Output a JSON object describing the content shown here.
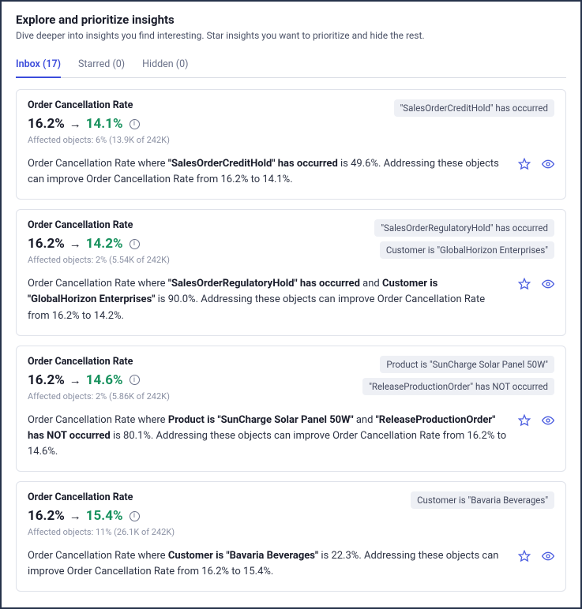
{
  "header": {
    "title": "Explore and prioritize insights",
    "subtitle": "Dive deeper into insights you find interesting. Star insights you want to prioritize and hide the rest."
  },
  "tabs": {
    "inbox": "Inbox (17)",
    "starred": "Starred (0)",
    "hidden": "Hidden (0)"
  },
  "arrow": "→",
  "info_glyph": "i",
  "cards": [
    {
      "metric": "Order Cancellation Rate",
      "before": "16.2%",
      "after": "14.1%",
      "affected": "Affected objects: 6% (13.9K of 242K)",
      "chips": [
        "\"SalesOrderCreditHold\" has occurred"
      ],
      "desc_pre": "Order Cancellation Rate where ",
      "desc_bold1": "\"SalesOrderCreditHold\" has occurred",
      "desc_mid1": " is 49.6%. Addressing these objects can improve Order Cancellation Rate from 16.2% to 14.1%.",
      "desc_bold2": "",
      "desc_mid2": ""
    },
    {
      "metric": "Order Cancellation Rate",
      "before": "16.2%",
      "after": "14.2%",
      "affected": "Affected objects: 2% (5.54K of 242K)",
      "chips": [
        "\"SalesOrderRegulatoryHold\" has occurred",
        "Customer is \"GlobalHorizon Enterprises\""
      ],
      "desc_pre": "Order Cancellation Rate where ",
      "desc_bold1": "\"SalesOrderRegulatoryHold\" has occurred",
      "desc_mid1": " and ",
      "desc_bold2": "Customer is \"GlobalHorizon Enterprises\"",
      "desc_mid2": " is 90.0%. Addressing these objects can improve Order Cancellation Rate from 16.2% to 14.2%."
    },
    {
      "metric": "Order Cancellation Rate",
      "before": "16.2%",
      "after": "14.6%",
      "affected": "Affected objects: 2% (5.86K of 242K)",
      "chips": [
        "Product is \"SunCharge Solar Panel 50W\"",
        "\"ReleaseProductionOrder\" has NOT occurred"
      ],
      "desc_pre": "Order Cancellation Rate where ",
      "desc_bold1": "Product is \"SunCharge Solar Panel 50W\"",
      "desc_mid1": " and ",
      "desc_bold2": "\"ReleaseProductionOrder\" has NOT occurred",
      "desc_mid2": " is 80.1%. Addressing these objects can improve Order Cancellation Rate from 16.2% to 14.6%."
    },
    {
      "metric": "Order Cancellation Rate",
      "before": "16.2%",
      "after": "15.4%",
      "affected": "Affected objects: 11% (26.1K of 242K)",
      "chips": [
        "Customer is \"Bavaria Beverages\""
      ],
      "desc_pre": "Order Cancellation Rate where ",
      "desc_bold1": "Customer is \"Bavaria Beverages\"",
      "desc_mid1": " is 22.3%. Addressing these objects can improve Order Cancellation Rate from 16.2% to 15.4%.",
      "desc_bold2": "",
      "desc_mid2": ""
    }
  ]
}
